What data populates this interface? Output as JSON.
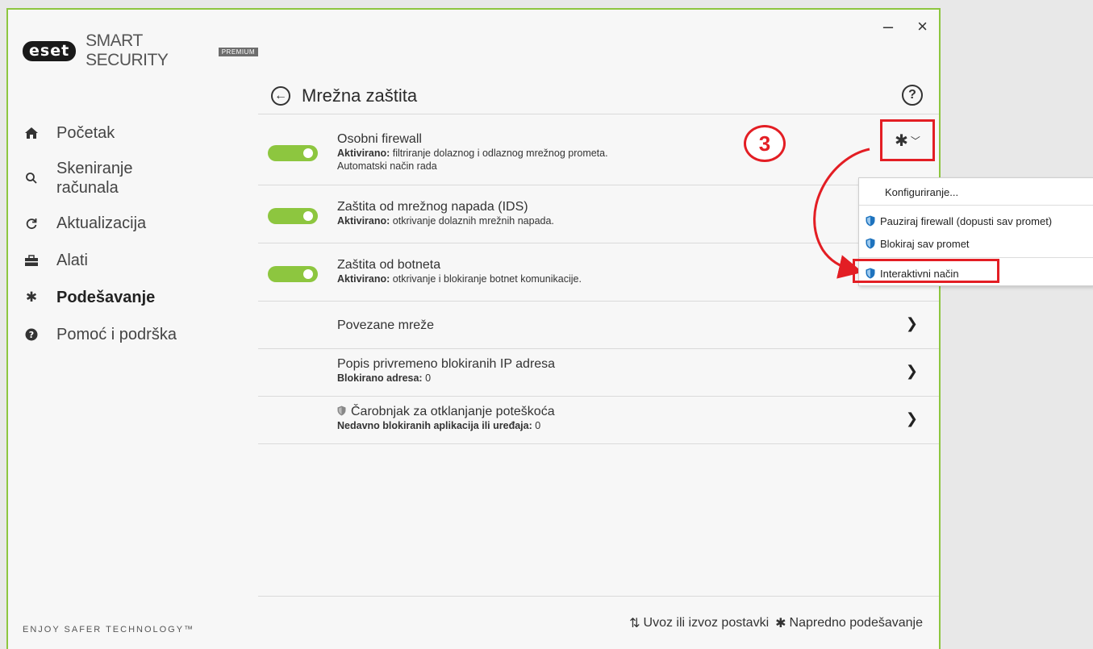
{
  "app": {
    "logo": "eset",
    "product": "SMART SECURITY",
    "edition": "PREMIUM",
    "tagline": "ENJOY SAFER TECHNOLOGY™"
  },
  "window_controls": {
    "minimize": "–",
    "close": "×"
  },
  "nav": {
    "items": [
      {
        "label": "Početak",
        "icon": "home-icon"
      },
      {
        "label": "Skeniranje računala",
        "icon": "search-icon"
      },
      {
        "label": "Aktualizacija",
        "icon": "refresh-icon"
      },
      {
        "label": "Alati",
        "icon": "toolbox-icon"
      },
      {
        "label": "Podešavanje",
        "icon": "gear-icon",
        "active": true
      },
      {
        "label": "Pomoć i podrška",
        "icon": "help-icon"
      }
    ]
  },
  "page": {
    "title": "Mrežna zaštita",
    "help": "?"
  },
  "rows": [
    {
      "title": "Osobni firewall",
      "desc_label": "Aktivirano:",
      "desc": " filtriranje dolaznog i odlaznog mrežnog prometa.",
      "desc2": "Automatski način rada",
      "enabled": true
    },
    {
      "title": "Zaštita od mrežnog napada (IDS)",
      "desc_label": "Aktivirano:",
      "desc": " otkrivanje dolaznih mrežnih napada.",
      "enabled": true
    },
    {
      "title": "Zaštita od botneta",
      "desc_label": "Aktivirano:",
      "desc": " otkrivanje i blokiranje botnet komunikacije.",
      "enabled": true
    },
    {
      "title": "Povezane mreže"
    },
    {
      "title": "Popis privremeno blokiranih IP adresa",
      "desc_label": "Blokirano adresa:",
      "desc": " 0"
    },
    {
      "title": "Čarobnjak za otklanjanje poteškoća",
      "desc_label": "Nedavno blokiranih aplikacija ili uređaja:",
      "desc": " 0"
    }
  ],
  "annotation": {
    "step": "3",
    "color": "#e31e24"
  },
  "dropdown": {
    "items": [
      {
        "label": "Konfiguriranje..."
      },
      {
        "label": "Pauziraj firewall (dopusti sav promet)",
        "icon": "shield-icon"
      },
      {
        "label": "Blokiraj sav promet",
        "icon": "shield-icon"
      },
      {
        "label": "Interaktivni način",
        "icon": "shield-icon",
        "highlighted": true
      }
    ]
  },
  "footer": {
    "import_export": "Uvoz ili izvoz postavki",
    "advanced": "Napredno podešavanje"
  },
  "colors": {
    "accent": "#8dc63f",
    "annotation": "#e31e24",
    "shield": "#1e73be"
  }
}
